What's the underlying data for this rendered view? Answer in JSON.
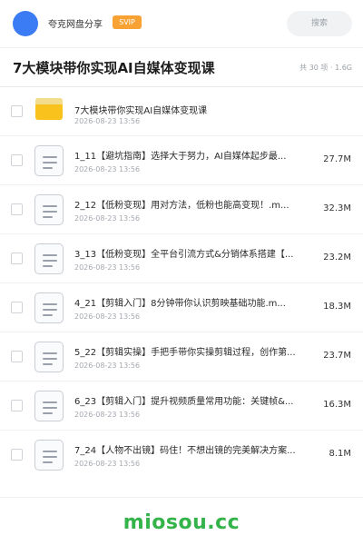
{
  "header": {
    "app_name": "夸克网盘分享",
    "badge": "SVIP",
    "search_placeholder": "搜索",
    "accent_color": "#3b7cf5",
    "badge_color": "#f7a233"
  },
  "share": {
    "title": "7大模块带你实现AI自媒体变现课",
    "summary": "共 30 项 · 1.6G"
  },
  "files": [
    {
      "icon": "folder-icon",
      "name": "7大模块带你实现AI自媒体变现课",
      "date": "2026-08-23 13:56",
      "size": ""
    },
    {
      "icon": "document-icon",
      "name": "1_11【避坑指南】选择大于努力，AI自媒体起步最...",
      "date": "2026-08-23 13:56",
      "size": "27.7M"
    },
    {
      "icon": "document-icon",
      "name": "2_12【低粉变现】用对方法，低粉也能高变现！.m...",
      "date": "2026-08-23 13:56",
      "size": "32.3M"
    },
    {
      "icon": "document-icon",
      "name": "3_13【低粉变现】全平台引流方式&分销体系搭建【...",
      "date": "2026-08-23 13:56",
      "size": "23.2M"
    },
    {
      "icon": "document-icon",
      "name": "4_21【剪辑入门】8分钟带你认识剪映基础功能.m...",
      "date": "2026-08-23 13:56",
      "size": "18.3M"
    },
    {
      "icon": "document-icon",
      "name": "5_22【剪辑实操】手把手带你实操剪辑过程，创作第...",
      "date": "2026-08-23 13:56",
      "size": "23.7M"
    },
    {
      "icon": "document-icon",
      "name": "6_23【剪辑入门】提升视频质量常用功能：关键帧&...",
      "date": "2026-08-23 13:56",
      "size": "16.3M"
    },
    {
      "icon": "document-icon",
      "name": "7_24【人物不出镜】码住！不想出镜的完美解决方案...",
      "date": "2026-08-23 13:56",
      "size": "8.1M"
    }
  ],
  "watermark": {
    "text": "miosou.cc",
    "color": "#34b34a"
  }
}
